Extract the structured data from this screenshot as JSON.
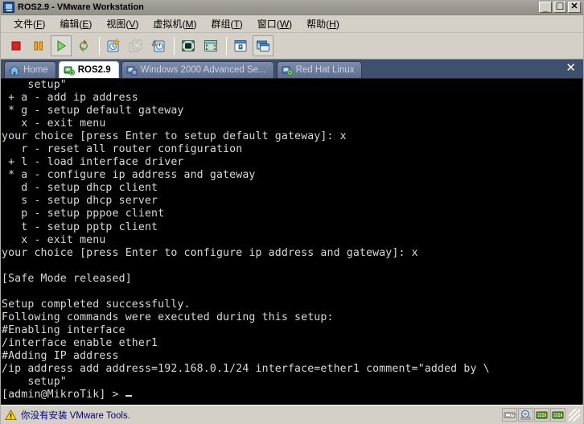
{
  "window": {
    "title": "ROS2.9 - VMware Workstation",
    "icon": "vmware-app-icon",
    "buttons": {
      "minimize": "_",
      "maximize": "☐",
      "close": "✕"
    }
  },
  "menubar": {
    "items": [
      {
        "label": "文件",
        "accel": "F",
        "name": "menu-file"
      },
      {
        "label": "编辑",
        "accel": "E",
        "name": "menu-edit"
      },
      {
        "label": "视图",
        "accel": "V",
        "name": "menu-view"
      },
      {
        "label": "虚拟机",
        "accel": "M",
        "name": "menu-vm"
      },
      {
        "label": "群组",
        "accel": "T",
        "name": "menu-team"
      },
      {
        "label": "窗口",
        "accel": "W",
        "name": "menu-window"
      },
      {
        "label": "帮助",
        "accel": "H",
        "name": "menu-help"
      }
    ]
  },
  "toolbar": {
    "buttons": [
      {
        "name": "power-off-button",
        "icon": "stop-square-icon",
        "state": "enabled"
      },
      {
        "name": "suspend-button",
        "icon": "pause-icon",
        "state": "enabled"
      },
      {
        "name": "power-on-button",
        "icon": "play-triangle-icon",
        "state": "pressed"
      },
      {
        "name": "reset-button",
        "icon": "reset-arrows-icon",
        "state": "enabled"
      },
      {
        "name": "snapshot-button",
        "icon": "take-snapshot-icon",
        "state": "enabled"
      },
      {
        "name": "revert-snapshot-button",
        "icon": "revert-snapshot-icon",
        "state": "disabled"
      },
      {
        "name": "snapshot-manager-button",
        "icon": "snapshot-manager-icon",
        "state": "enabled"
      },
      {
        "name": "fullscreen-button",
        "icon": "fullscreen-icon",
        "state": "enabled"
      },
      {
        "name": "quick-switch-button",
        "icon": "quick-switch-icon",
        "state": "enabled"
      },
      {
        "name": "summary-view-button",
        "icon": "summary-view-icon",
        "state": "enabled"
      },
      {
        "name": "console-view-button",
        "icon": "console-view-icon",
        "state": "pressed"
      }
    ]
  },
  "tabs": {
    "close_label": "✕",
    "items": [
      {
        "label": "Home",
        "icon": "home-icon",
        "active": false
      },
      {
        "label": "ROS2.9",
        "icon": "vm-powered-on-icon",
        "active": true
      },
      {
        "label": "Windows 2000 Advanced Se...",
        "icon": "vm-icon",
        "active": false
      },
      {
        "label": "Red Hat Linux",
        "icon": "vm-powered-on-icon",
        "active": false
      }
    ]
  },
  "terminal": {
    "lines": [
      "    setup\"",
      " + a - add ip address",
      " * g - setup default gateway",
      "   x - exit menu",
      "your choice [press Enter to setup default gateway]: x",
      "   r - reset all router configuration",
      " + l - load interface driver",
      " * a - configure ip address and gateway",
      "   d - setup dhcp client",
      "   s - setup dhcp server",
      "   p - setup pppoe client",
      "   t - setup pptp client",
      "   x - exit menu",
      "your choice [press Enter to configure ip address and gateway]: x",
      "",
      "[Safe Mode released]",
      "",
      "Setup completed successfully.",
      "Following commands were executed during this setup:",
      "#Enabling interface",
      "/interface enable ether1",
      "#Adding IP address",
      "/ip address add address=192.168.0.1/24 interface=ether1 comment=\"added by \\",
      "    setup\""
    ],
    "prompt": "[admin@MikroTik] > ",
    "cursor": "_",
    "background": "#000000",
    "foreground": "#d9d9d9"
  },
  "statusbar": {
    "warning_icon": "warning-triangle-icon",
    "message": "你没有安装 VMware Tools.",
    "devices": [
      {
        "name": "floppy-device-icon",
        "label": "floppy"
      },
      {
        "name": "cdrom-device-icon",
        "label": "cd-rom"
      },
      {
        "name": "network-adapter-1-icon",
        "label": "ethernet1"
      },
      {
        "name": "network-adapter-2-icon",
        "label": "ethernet2"
      }
    ],
    "resize_grip": "resize-grip"
  },
  "colors": {
    "titlebar": "#9c9b93",
    "chrome": "#d4d0c8",
    "tabbar": "#3f4f6e",
    "terminal_bg": "#000000",
    "terminal_fg": "#d9d9d9",
    "status_text": "#000080"
  }
}
